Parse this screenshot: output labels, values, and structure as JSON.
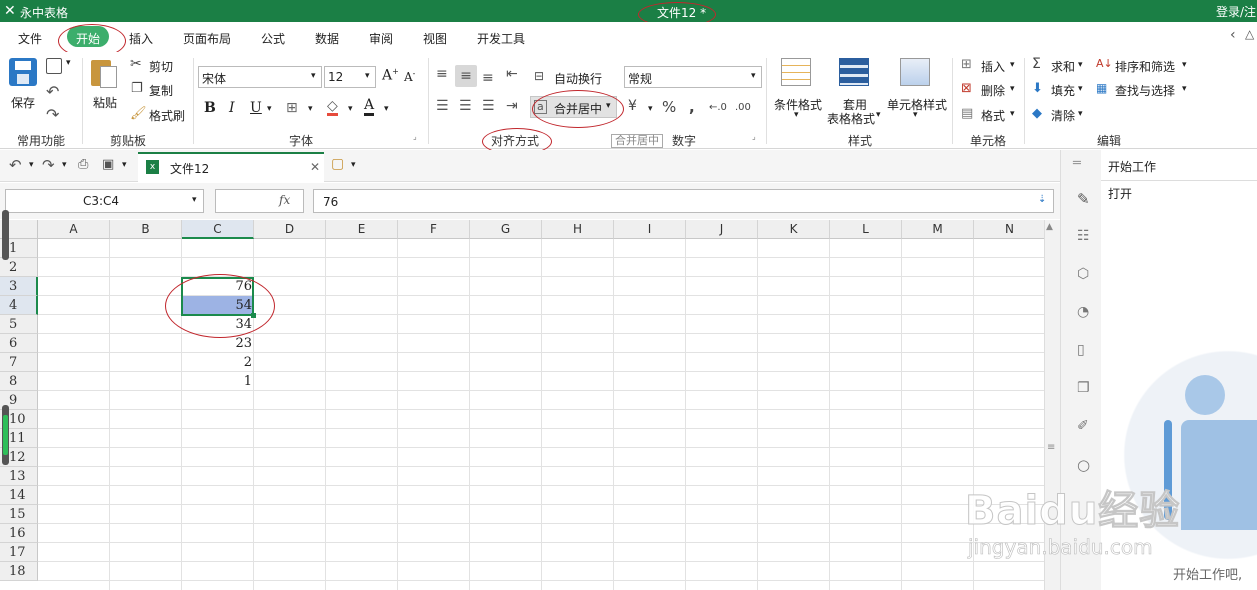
{
  "title_bar": {
    "app_name": "永中表格",
    "document_title": "文件12 *",
    "login_text": "登录/注"
  },
  "menu": [
    "文件",
    "开始",
    "插入",
    "页面布局",
    "公式",
    "数据",
    "审阅",
    "视图",
    "开发工具"
  ],
  "ribbon": {
    "save": "保存",
    "paste": "粘贴",
    "cut": "剪切",
    "copy": "复制",
    "format_painter": "格式刷",
    "group_common": "常用功能",
    "group_clipboard": "剪贴板",
    "font_name": "宋体",
    "font_size": "12",
    "bold": "B",
    "italic": "I",
    "underline": "U",
    "group_font": "字体",
    "wrap_text": "自动换行",
    "merge_center": "合并居中",
    "group_align": "对齐方式",
    "number_format": "常规",
    "tooltip": "合并居中",
    "group_number": "数字",
    "cond_format": "条件格式",
    "table_format_1": "套用",
    "table_format_2": "表格格式",
    "cell_style": "单元格样式",
    "group_style": "样式",
    "insert": "插入",
    "delete": "删除",
    "format": "格式",
    "group_cells": "单元格",
    "sum": "求和",
    "fill": "填充",
    "clear": "清除",
    "sort_filter": "排序和筛选",
    "find_select": "查找与选择",
    "group_edit": "编辑"
  },
  "tab": {
    "doc_name": "文件12"
  },
  "formula_bar": {
    "name_box": "C3:C4",
    "fx": "fx",
    "value": "76"
  },
  "sheet": {
    "columns": [
      "A",
      "B",
      "C",
      "D",
      "E",
      "F",
      "G",
      "H",
      "I",
      "J",
      "K",
      "L",
      "M",
      "N"
    ],
    "rows": [
      "1",
      "2",
      "3",
      "4",
      "5",
      "6",
      "7",
      "8",
      "9",
      "10",
      "11",
      "12",
      "13",
      "14",
      "15",
      "16",
      "17",
      "18"
    ],
    "values_c": [
      "76",
      "54",
      "34",
      "23",
      "2",
      "1"
    ]
  },
  "right_panel": {
    "title": "开始工作",
    "open": "打开",
    "footer": "开始工作吧,"
  },
  "watermark": {
    "brand": "Baidu经验",
    "url": "jingyan.baidu.com"
  },
  "colors": {
    "brand_green": "#1b7f45",
    "selection": "#9db3e4",
    "annotation_red": "#c1272d"
  }
}
